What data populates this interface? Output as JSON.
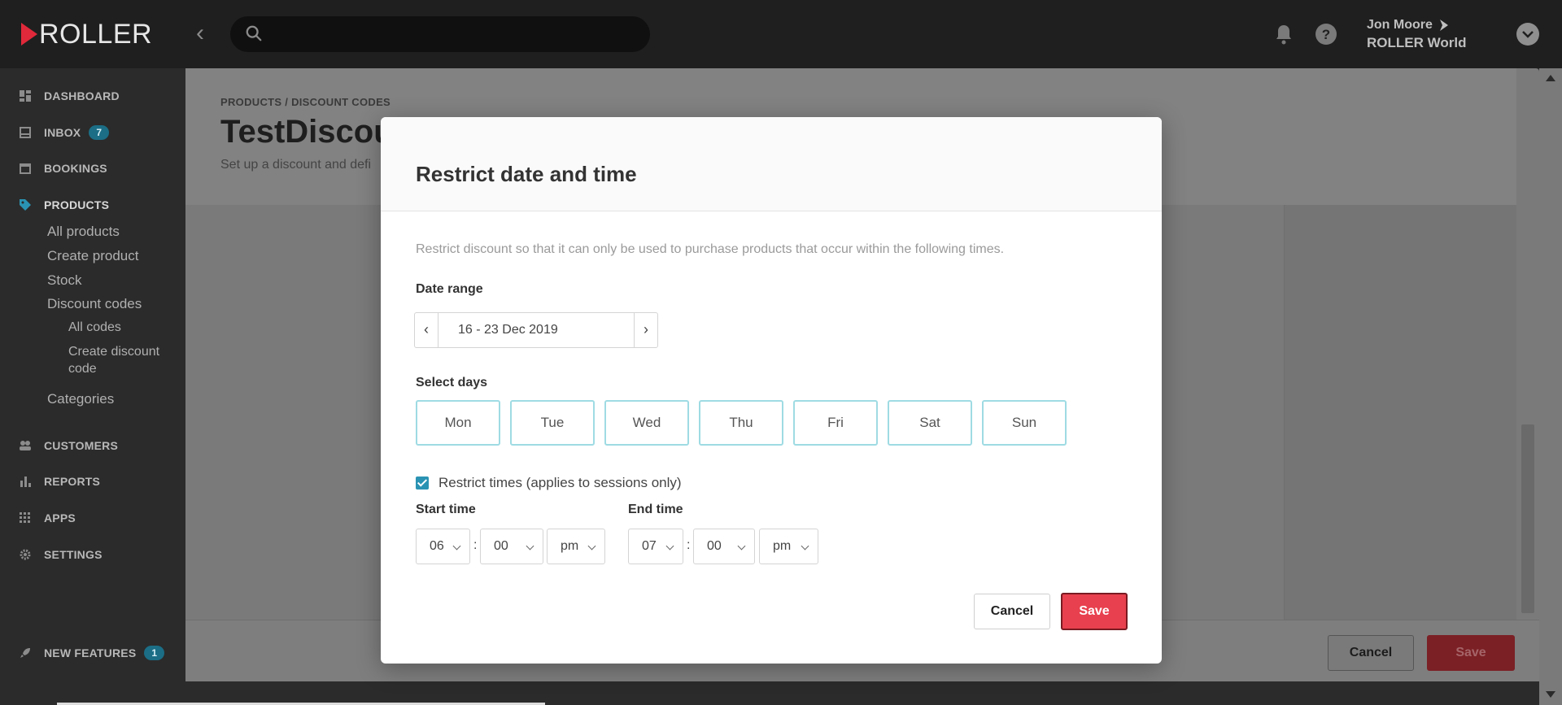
{
  "app": {
    "logo_text": "ROLLER",
    "brand_color": "#e0293a"
  },
  "topbar": {
    "search_placeholder": "",
    "user_name": "Jon Moore",
    "user_org": "ROLLER World"
  },
  "sidebar": {
    "dashboard": "DASHBOARD",
    "inbox": "INBOX",
    "inbox_count": "7",
    "bookings": "BOOKINGS",
    "products": "PRODUCTS",
    "products_sub": [
      "All products",
      "Create product",
      "Stock",
      "Discount codes"
    ],
    "discount_sub": [
      "All codes",
      "Create discount code"
    ],
    "categories": "Categories",
    "customers": "CUSTOMERS",
    "reports": "REPORTS",
    "apps": "APPS",
    "settings": "SETTINGS",
    "new_features": "NEW FEATURES",
    "new_features_count": "1"
  },
  "page": {
    "breadcrumb": "PRODUCTS  /  DISCOUNT CODES",
    "title": "TestDiscou",
    "subtitle": "Set up a discount and defi",
    "cancel_label": "Cancel",
    "save_label": "Save"
  },
  "modal": {
    "title": "Restrict date and time",
    "intro": "Restrict discount so that it can only be used to purchase products that occur within the following times.",
    "date_range_label": "Date range",
    "date_range_value": "16 - 23 Dec 2019",
    "select_days_label": "Select days",
    "days": [
      "Mon",
      "Tue",
      "Wed",
      "Thu",
      "Fri",
      "Sat",
      "Sun"
    ],
    "restrict_times_label": "Restrict times (applies to sessions only)",
    "restrict_times_checked": true,
    "start_time_label": "Start time",
    "start_hour": "06",
    "start_minute": "00",
    "start_ampm": "pm",
    "end_time_label": "End time",
    "end_hour": "07",
    "end_minute": "00",
    "end_ampm": "pm",
    "cancel_label": "Cancel",
    "save_label": "Save",
    "accent_color": "#2a93b3",
    "save_color": "#e8404e"
  }
}
